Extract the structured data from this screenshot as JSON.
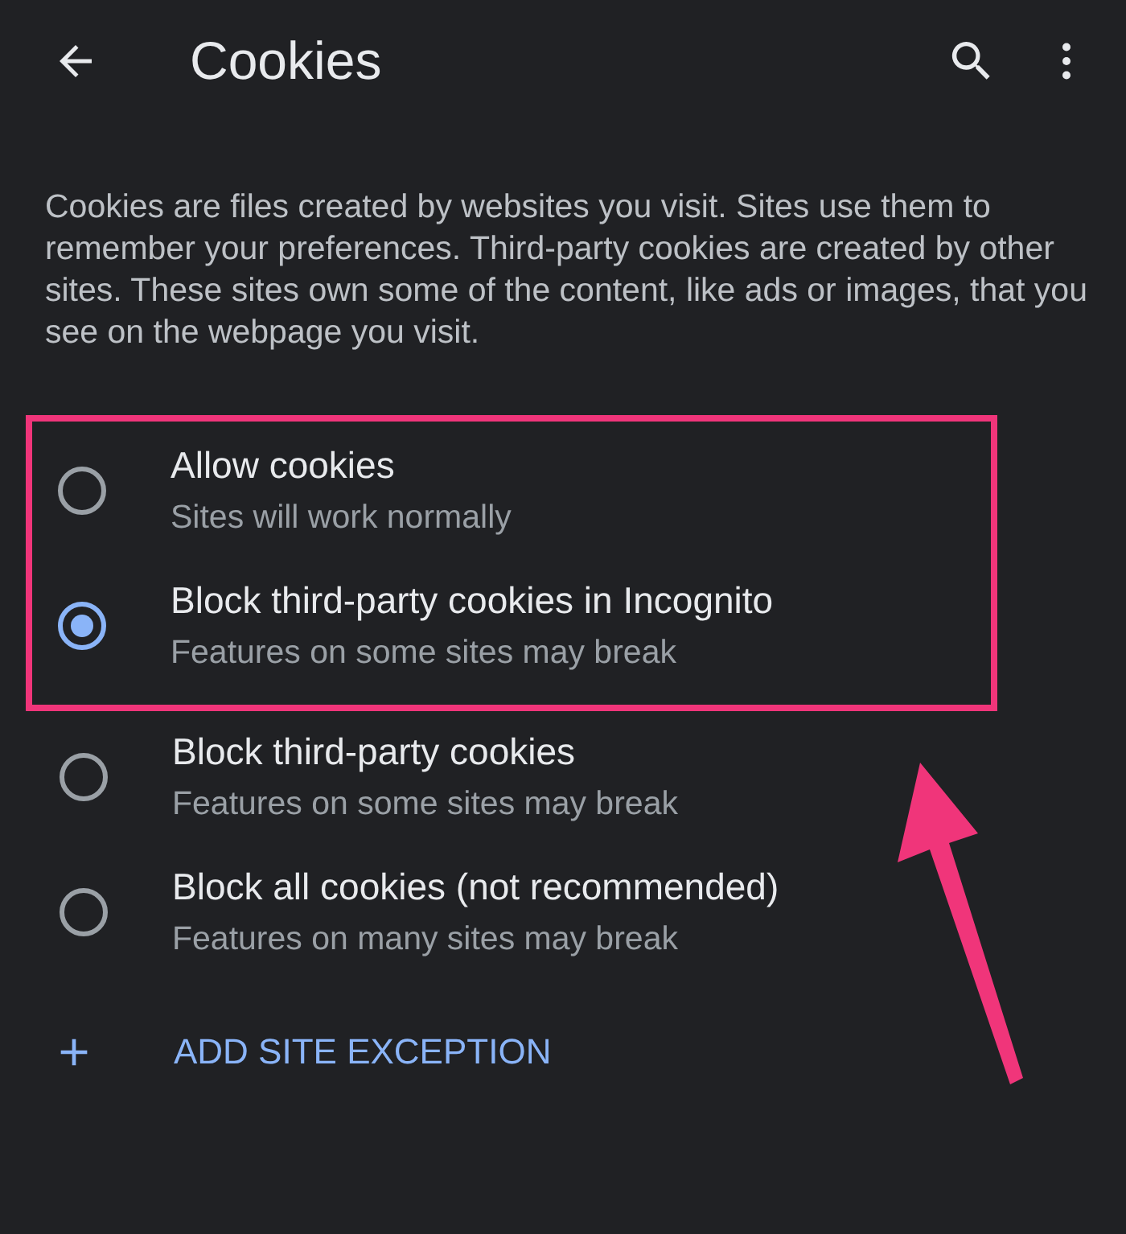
{
  "app_bar": {
    "title": "Cookies"
  },
  "description": "Cookies are files created by websites you visit. Sites use them to remember your preferences. Third-party cookies are created by other sites. These sites own some of the content, like ads or images, that you see on the webpage you visit.",
  "options": [
    {
      "title": "Allow cookies",
      "subtitle": "Sites will work normally",
      "selected": false,
      "highlighted": true
    },
    {
      "title": "Block third-party cookies in Incognito",
      "subtitle": "Features on some sites may break",
      "selected": true,
      "highlighted": true
    },
    {
      "title": "Block third-party cookies",
      "subtitle": "Features on some sites may break",
      "selected": false,
      "highlighted": false
    },
    {
      "title": "Block all cookies (not recommended)",
      "subtitle": "Features on many sites may break",
      "selected": false,
      "highlighted": false
    }
  ],
  "add_exception": {
    "label": "ADD SITE EXCEPTION"
  }
}
